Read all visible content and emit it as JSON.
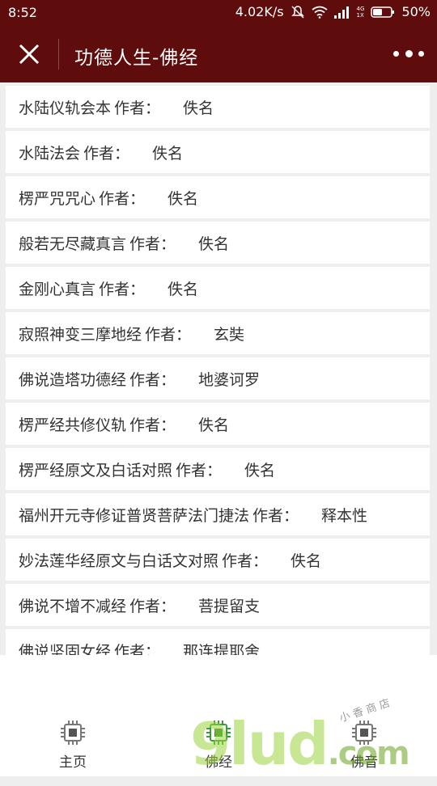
{
  "status_bar": {
    "time": "8:52",
    "speed": "4.02K/s",
    "network": "4G",
    "network_sub": "1X",
    "battery": "50%"
  },
  "header": {
    "title": "功德人生-佛经",
    "accent_color": "#5f0c0c"
  },
  "list": {
    "author_prefix": "作者：",
    "items": [
      {
        "title": "水陆仪轨会本",
        "author": "佚名"
      },
      {
        "title": "水陆法会",
        "author": "佚名"
      },
      {
        "title": "楞严咒咒心",
        "author": "佚名"
      },
      {
        "title": "般若无尽藏真言",
        "author": "佚名"
      },
      {
        "title": "金刚心真言",
        "author": "佚名"
      },
      {
        "title": "寂照神变三摩地经",
        "author": "玄奘"
      },
      {
        "title": "佛说造塔功德经",
        "author": "地婆诃罗"
      },
      {
        "title": "楞严经共修仪轨",
        "author": "佚名"
      },
      {
        "title": "楞严经原文及白话对照",
        "author": "佚名"
      },
      {
        "title": "福州开元寺修证普贤菩萨法门捷法",
        "author": "释本性"
      },
      {
        "title": "妙法莲华经原文与白话文对照",
        "author": "佚名"
      },
      {
        "title": "佛说不增不减经",
        "author": "菩提留支"
      },
      {
        "title": "佛说坚固女经",
        "author": "那连提耶舍"
      }
    ]
  },
  "tabs": [
    {
      "label": "主页",
      "icon": "chip-icon",
      "active": false
    },
    {
      "label": "佛经",
      "icon": "chip-icon",
      "active": true
    },
    {
      "label": "佛音",
      "icon": "chip-icon",
      "active": false
    }
  ],
  "watermark": {
    "text": "9lud",
    "suffix": ".com",
    "small": "小 香 商 店"
  }
}
